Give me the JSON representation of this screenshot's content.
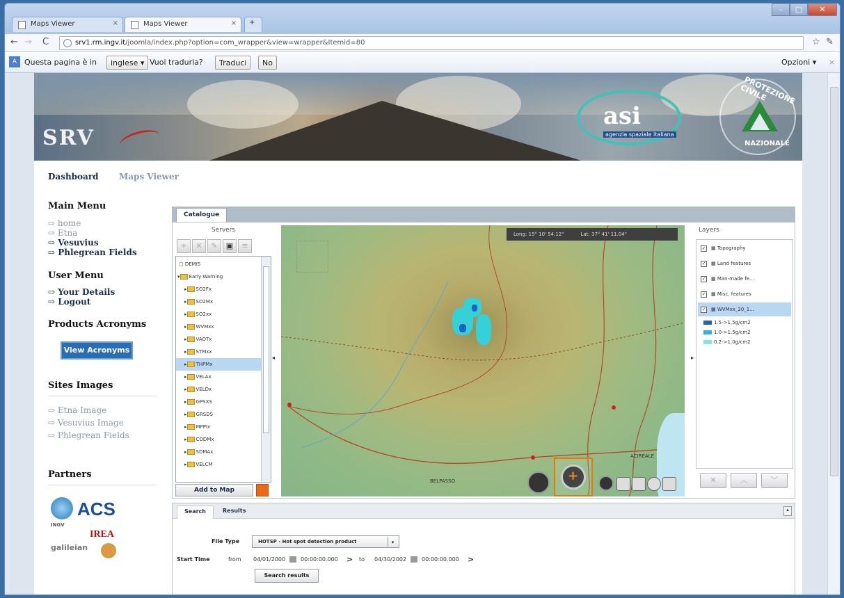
{
  "browser": {
    "tabs": [
      {
        "label": "Maps Viewer"
      },
      {
        "label": "Maps Viewer"
      }
    ],
    "url_host": "srv1.rm.ingv.it",
    "url_path": "/joomla/index.php?option=com_wrapper&view=wrapper&Itemid=80",
    "translate": {
      "prompt": "Questa pagina è in",
      "language": "inglese",
      "question": "Vuoi tradurla?",
      "translate_btn": "Traduci",
      "no_btn": "No",
      "options": "Opzioni"
    }
  },
  "banner": {
    "logo": "SRV",
    "asi_big": "asi",
    "asi_caption": "agenzia spaziale italiana",
    "prot_top": "PROTEZIONE CIVILE",
    "prot_bottom": "NAZIONALE"
  },
  "topnav": {
    "dashboard": "Dashboard",
    "maps_viewer": "Maps Viewer"
  },
  "sidebar": {
    "main_menu": "Main Menu",
    "main_items": [
      "home",
      "Etna",
      "Vesuvius",
      "Phlegrean Fields"
    ],
    "user_menu": "User Menu",
    "user_items": [
      "Your Details",
      "Logout"
    ],
    "products": "Products Acronyms",
    "view_acronyms": "View Acronyms",
    "sites": "Sites Images",
    "site_items": [
      "Etna Image",
      "Vesuvius Image",
      "Phlegrean Fields"
    ],
    "partners": "Partners",
    "partner_logos": [
      "ACS",
      "INGV",
      "IREA",
      "galileian"
    ]
  },
  "catalogue": {
    "tab": "Catalogue",
    "servers_title": "Servers",
    "tree": [
      "DEMIS",
      "Early Warning",
      "SO2Fx",
      "SO2Mx",
      "SO2xx",
      "WVMxx",
      "VAOTx",
      "STMxx",
      "THPMx",
      "VELAx",
      "VELDx",
      "GPSXS",
      "GRSDS",
      "MPPIx",
      "CODMx",
      "SDMAx",
      "VELCM"
    ],
    "add_to_map": "Add to Map",
    "coords": {
      "long": "Long: 15° 10' 54.12\"",
      "lat": "Lat: 37° 41' 11.04\""
    },
    "towns": [
      "BELPASSO",
      "ACIREALE"
    ],
    "layers_title": "Layers",
    "layers": [
      "Topography",
      "Land features",
      "Man-made fe...",
      "Misc. features",
      "WVMxx_20_1..."
    ],
    "legend": [
      {
        "label": "1.5->1.5g/cm2",
        "color": "#1d63c0"
      },
      {
        "label": "1.0->1.5g/cm2",
        "color": "#2db3e6"
      },
      {
        "label": "0.2->1.0g/cm2",
        "color": "#7fe8e8"
      }
    ]
  },
  "search": {
    "tabs": [
      "Search",
      "Results"
    ],
    "file_type_label": "File Type",
    "file_type_value": "HOTSP - Hot spot detection product",
    "start_time_label": "Start Time",
    "from_label": "from",
    "from_date": "04/01/2000",
    "from_time": "00:00:00.000",
    "to_label": "to",
    "to_date": "04/30/2002",
    "to_time": "00:00:00.000",
    "search_btn": "Search results"
  }
}
